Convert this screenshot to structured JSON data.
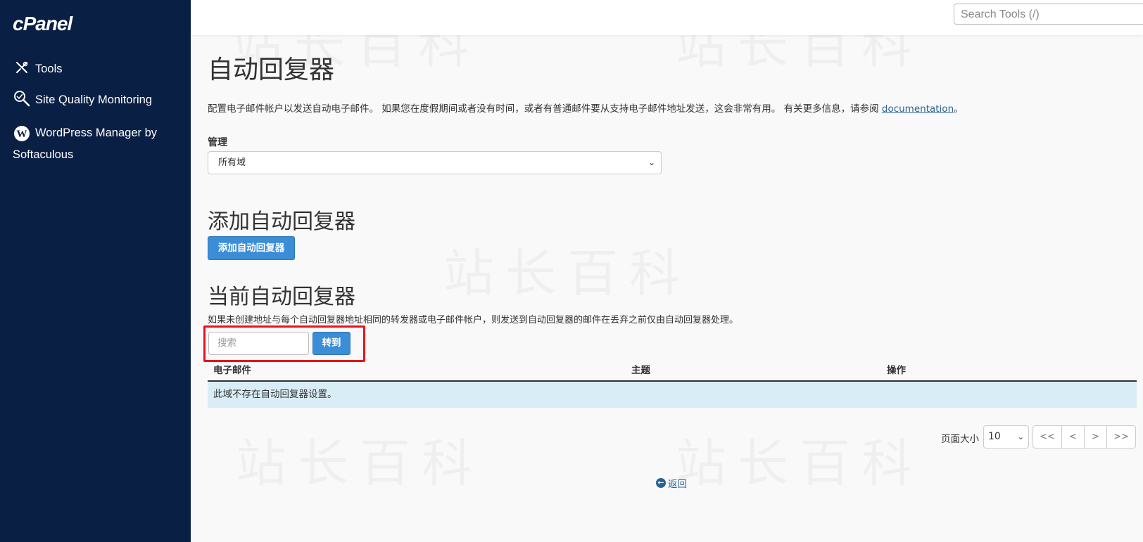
{
  "brand": {
    "logo": "cPanel"
  },
  "sidebar": {
    "items": [
      {
        "label": "Tools",
        "icon": "tools-icon"
      },
      {
        "label": "Site Quality Monitoring",
        "icon": "magnifier-icon"
      },
      {
        "label": "WordPress Manager by Softaculous",
        "icon": "wordpress-icon"
      }
    ]
  },
  "topbar": {
    "search_placeholder": "Search Tools (/)"
  },
  "page": {
    "title": "自动回复器",
    "description": "配置电子邮件帐户以发送自动电子邮件。 如果您在度假期间或者没有时间，或者有普通邮件要从支持电子邮件地址发送，这会非常有用。 有关更多信息，请参阅 ",
    "doc_link": "documentation",
    "description_end": "。",
    "manage_label": "管理",
    "domain_selected": "所有域"
  },
  "add_section": {
    "title": "添加自动回复器",
    "button": "添加自动回复器"
  },
  "current_section": {
    "title": "当前自动回复器",
    "note": "如果未创建地址与每个自动回复器地址相同的转发器或电子邮件帐户，则发送到自动回复器的邮件在丢弃之前仅由自动回复器处理。",
    "search_placeholder": "搜索",
    "go_button": "转到"
  },
  "table": {
    "columns": [
      "电子邮件",
      "主题",
      "操作"
    ],
    "empty_message": "此域不存在自动回复器设置。"
  },
  "pagination": {
    "page_size_label": "页面大小",
    "page_size": "10",
    "buttons": [
      "<<",
      "<",
      ">",
      ">>"
    ]
  },
  "back_link": "返回",
  "watermark": "站长百科",
  "colors": {
    "sidebar": "#0a1f44",
    "primary": "#3a8dd6",
    "highlight": "#e8131b",
    "info_row": "#d9edf7"
  }
}
